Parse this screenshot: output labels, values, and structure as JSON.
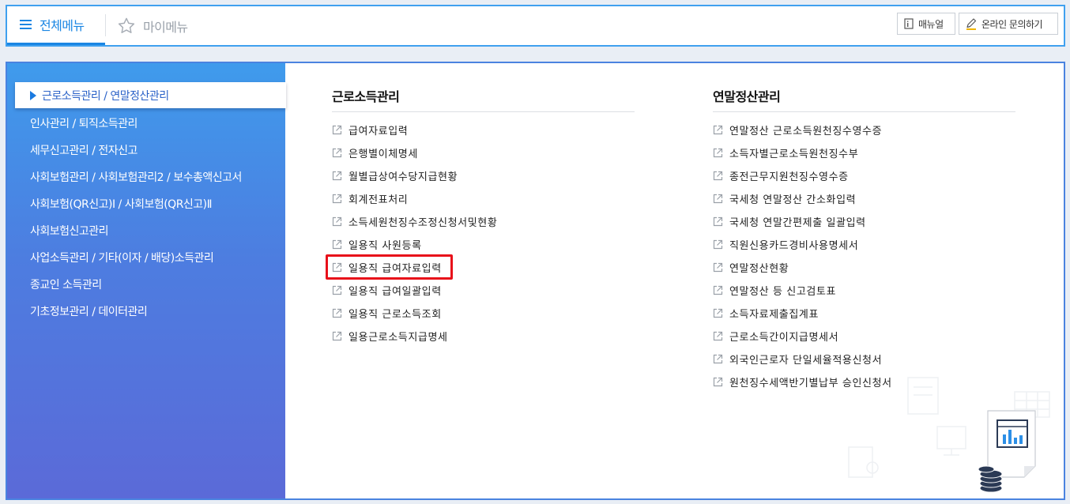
{
  "topbar": {
    "all_menu_label": "전체메뉴",
    "my_menu_label": "마이메뉴",
    "manual_label": "매뉴얼",
    "inquiry_label": "온라인 문의하기"
  },
  "sidebar": {
    "active": "근로소득관리 / 연말정산관리",
    "items": [
      "인사관리 / 퇴직소득관리",
      "세무신고관리 / 전자신고",
      "사회보험관리 / 사회보험관리2 / 보수총액신고서",
      "사회보험(QR신고)Ⅰ / 사회보험(QR신고)Ⅱ",
      "사회보험신고관리",
      "사업소득관리 / 기타(이자 / 배당)소득관리",
      "종교인 소득관리",
      "기초정보관리 / 데이터관리"
    ]
  },
  "columns": [
    {
      "title": "근로소득관리",
      "links": [
        "급여자료입력",
        "은행별이체명세",
        "월별급상여수당지급현황",
        "회계전표처리",
        "소득세원천징수조정신청서및현황",
        "일용직 사원등록",
        "일용직 급여자료입력",
        "일용직 급여일괄입력",
        "일용직 근로소득조회",
        "일용근로소득지급명세"
      ]
    },
    {
      "title": "연말정산관리",
      "links": [
        "연말정산 근로소득원천징수영수증",
        "소득자별근로소득원천징수부",
        "종전근무지원천징수영수증",
        "국세청 연말정산 간소화입력",
        "국세청 연말간편제출 일괄입력",
        "직원신용카드경비사용명세서",
        "연말정산현황",
        "연말정산 등 신고검토표",
        "소득자료제출집계표",
        "근로소득간이지급명세서",
        "외국인근로자 단일세율적용신청서",
        "원천징수세액반기별납부 승인신청서"
      ]
    }
  ],
  "highlighted_link": "일용직 급여자료입력",
  "colors": {
    "accent": "#1a86e3",
    "sidebar_top": "#3f9bec",
    "sidebar_bottom": "#5b6ad8",
    "highlight": "#e8101a"
  }
}
